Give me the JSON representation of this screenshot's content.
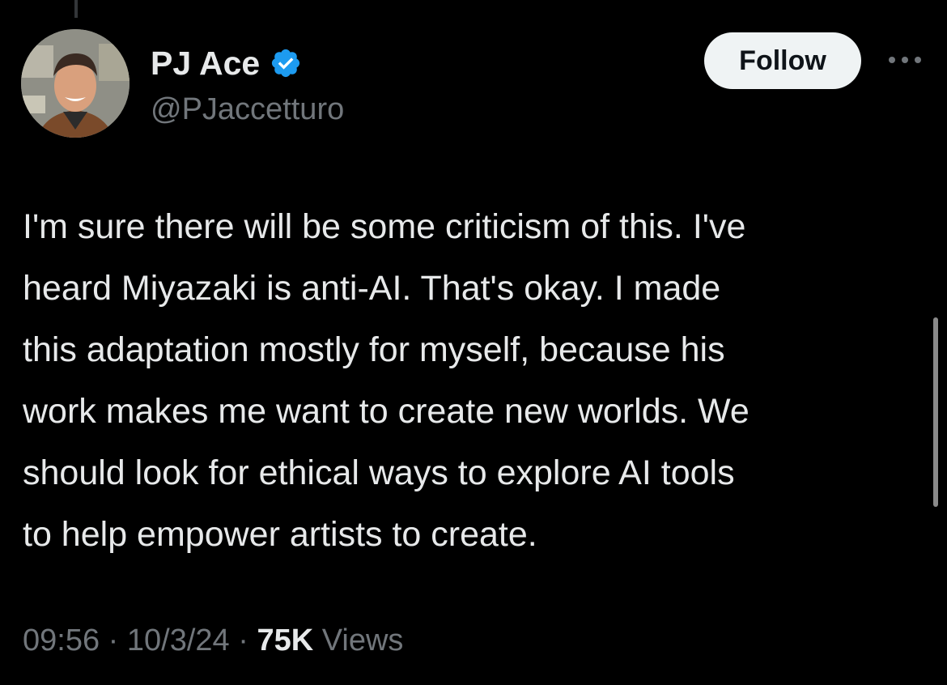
{
  "author": {
    "display_name": "PJ Ace",
    "handle": "@PJaccetturo",
    "verified": true,
    "verified_color": "#1d9bf0",
    "avatar": "profile-photo"
  },
  "actions": {
    "follow_label": "Follow",
    "more_icon": "more-dots-icon"
  },
  "tweet": {
    "text": "I'm sure there will be some criticism of this. I've\nheard Miyazaki is anti-AI. That's okay. I made\nthis adaptation mostly for myself, because his\nwork makes me want to create new worlds. We\nshould look for ethical ways to explore AI tools\nto help empower artists to create."
  },
  "meta": {
    "time": "09:56",
    "separator": "·",
    "date": "10/3/24",
    "views_count": "75K",
    "views_label": "Views"
  },
  "colors": {
    "background": "#000000",
    "primary_text": "#e7e9ea",
    "secondary_text": "#71767b",
    "follow_bg": "#eff3f4",
    "follow_text": "#0f1419"
  }
}
